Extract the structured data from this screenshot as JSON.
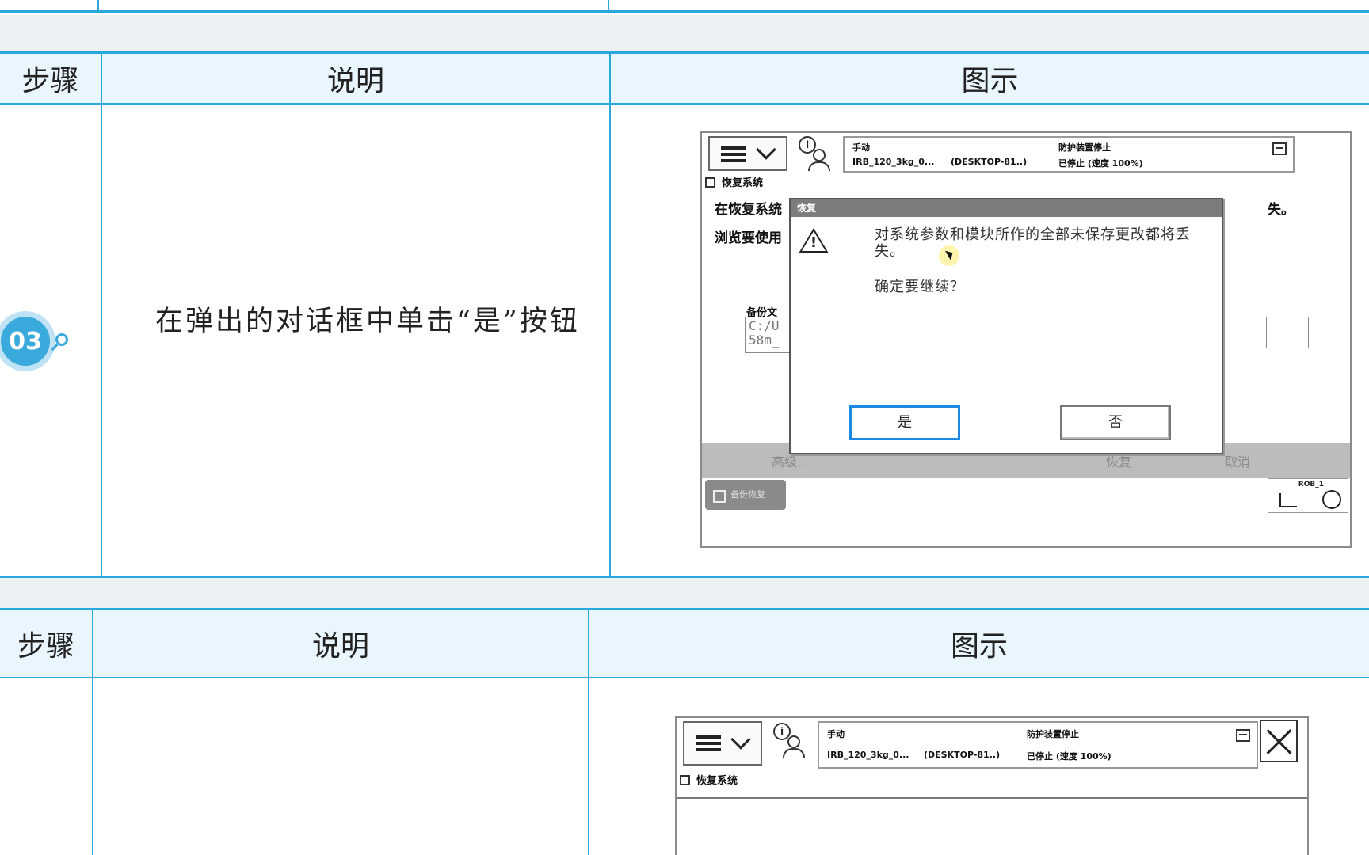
{
  "headers": {
    "step": "步骤",
    "desc": "说明",
    "figure": "图示"
  },
  "step3": {
    "number": "03",
    "description": "在弹出的对话框中单击“是”按钮",
    "screen": {
      "status_mode": "手动",
      "status_robot": "IRB_120_3kg_0...",
      "status_host": "(DESKTOP-81..)",
      "status_guard": "防护装置停止",
      "status_state": "已停止 (速度 100%)",
      "subtitle": "恢复系统",
      "bg_line1": "在恢复系统",
      "bg_line1_tail": "失。",
      "bg_line2": "浏览要使用",
      "backup_label": "备份文",
      "path_text": "C:/U\n58m_",
      "dialog": {
        "title": "恢复",
        "message": "对系统参数和模块所作的全部未保存更改都将丢失。",
        "question": "确定要继续？",
        "yes": "是",
        "no": "否"
      },
      "cmd_advanced": "高级...",
      "cmd_restore": "恢复",
      "cmd_cancel": "取消",
      "taskbar_label": "备份恢复",
      "rob_label": "ROB_1"
    }
  },
  "step4": {
    "screen": {
      "status_mode": "手动",
      "status_robot": "IRB_120_3kg_0...",
      "status_host": "(DESKTOP-81..)",
      "status_guard": "防护装置停止",
      "status_state": "已停止 (速度 100%)",
      "subtitle": "恢复系统"
    }
  }
}
